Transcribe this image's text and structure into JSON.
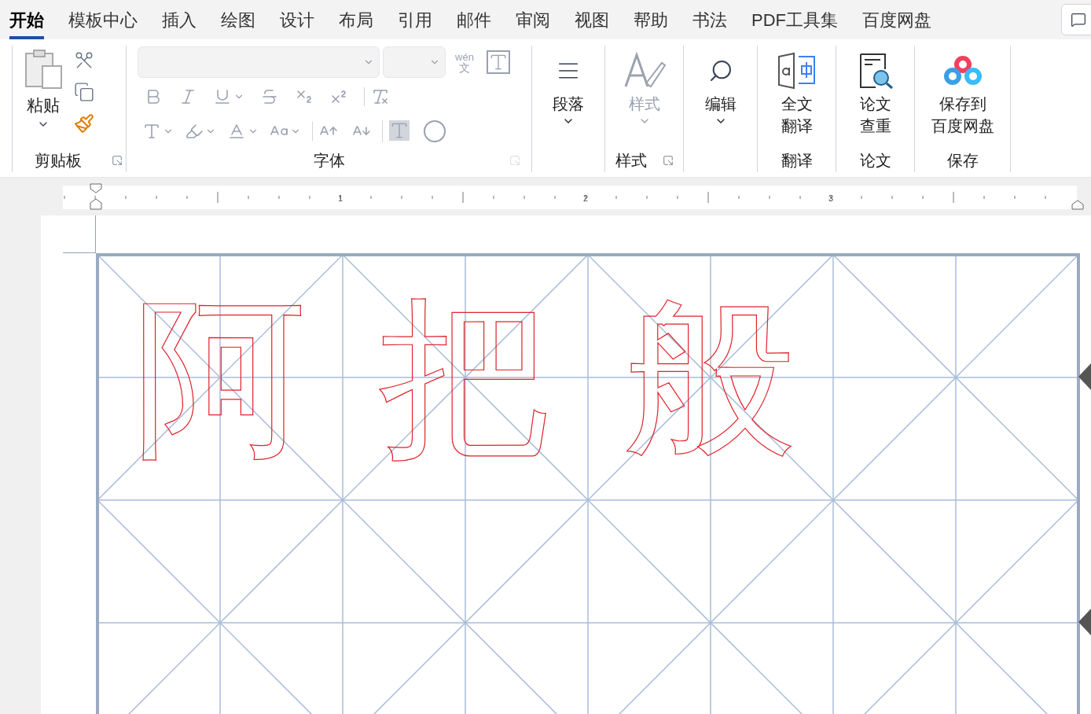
{
  "tabs": [
    {
      "label": "开始",
      "selected": true
    },
    {
      "label": "模板中心",
      "selected": false
    },
    {
      "label": "插入",
      "selected": false
    },
    {
      "label": "绘图",
      "selected": false
    },
    {
      "label": "设计",
      "selected": false
    },
    {
      "label": "布局",
      "selected": false
    },
    {
      "label": "引用",
      "selected": false
    },
    {
      "label": "邮件",
      "selected": false
    },
    {
      "label": "审阅",
      "selected": false
    },
    {
      "label": "视图",
      "selected": false
    },
    {
      "label": "帮助",
      "selected": false
    },
    {
      "label": "书法",
      "selected": false
    },
    {
      "label": "PDF工具集",
      "selected": false
    },
    {
      "label": "百度网盘",
      "selected": false
    }
  ],
  "clipboard": {
    "paste_label": "粘贴",
    "group_label": "剪贴板"
  },
  "font": {
    "group_label": "字体",
    "disabled": true,
    "phonetic_top": "wén",
    "phonetic_bottom": "文"
  },
  "big_groups": [
    {
      "kind": "dropdown",
      "label_lines": [
        "段落"
      ],
      "disabled": false
    },
    {
      "kind": "dropdown",
      "label_lines": [
        "样式"
      ],
      "group_label": "样式",
      "disabled": true
    },
    {
      "kind": "dropdown",
      "label_lines": [
        "编辑"
      ],
      "disabled": false
    },
    {
      "kind": "button",
      "label_lines": [
        "全文",
        "翻译"
      ],
      "group_label": "翻译",
      "disabled": false
    },
    {
      "kind": "button",
      "label_lines": [
        "论文",
        "查重"
      ],
      "group_label": "论文",
      "disabled": false
    },
    {
      "kind": "button",
      "label_lines": [
        "保存到",
        "百度网盘"
      ],
      "group_label": "保存",
      "disabled": false
    }
  ],
  "ruler": {
    "numbers": [
      "1",
      "2",
      "3"
    ]
  },
  "document": {
    "cells": [
      "阿",
      "把",
      "般",
      ""
    ]
  }
}
